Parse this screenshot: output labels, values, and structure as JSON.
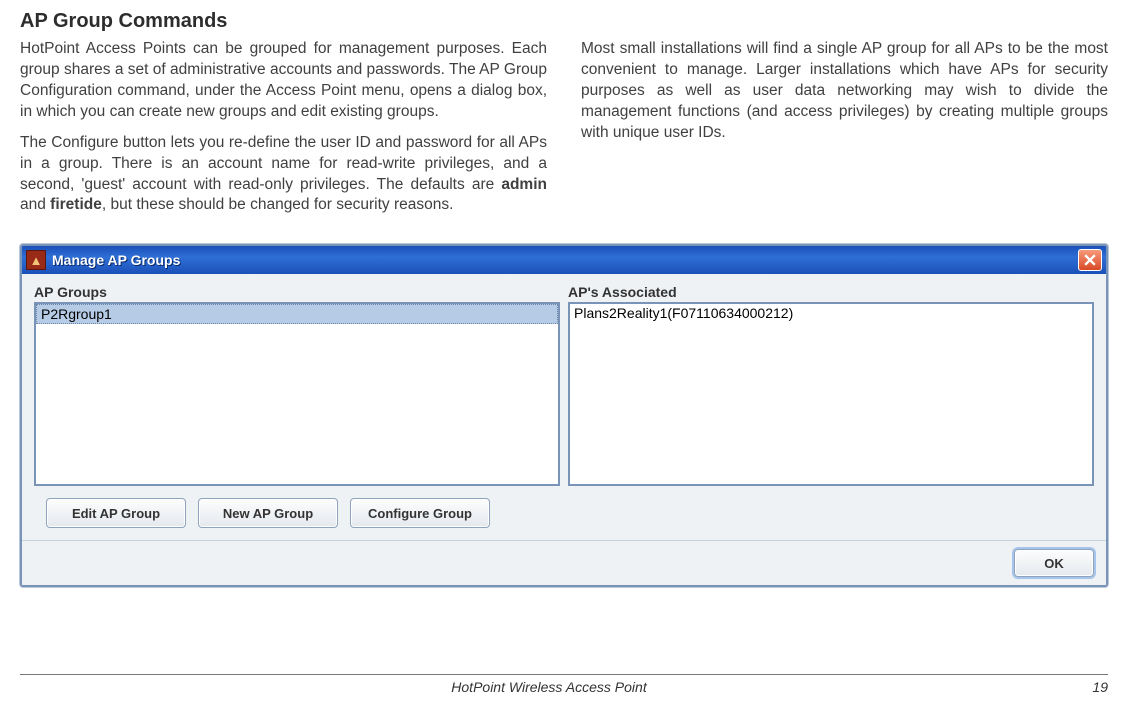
{
  "heading": "AP Group Commands",
  "paragraphs": {
    "p1": "HotPoint Access Points can be grouped for management purposes. Each group shares a set of administrative accounts and passwords. The AP Group Configuration command, under the Access Point menu, opens a dialog box, in which you can create new groups and edit existing groups.",
    "p2a": "The Configure button lets you re-define the user ID and password for all APs in a group. There is an account name for read-write privileges, and a second, 'guest' account with read-only privileges. The defaults are ",
    "p2b": "admin",
    "p2c": " and ",
    "p2d": "firetide",
    "p2e": ", but these should be changed for security reasons.",
    "p3": "Most small installations will find a single AP group for all APs to be the most convenient to manage. Larger installations which have APs for security purposes as well as user data networking may wish to divide the management functions (and access privileges) by creating multiple groups with unique user IDs."
  },
  "dialog": {
    "title": "Manage AP Groups",
    "groups_label": "AP Groups",
    "assoc_label": "AP's Associated",
    "group_item": "P2Rgroup1",
    "assoc_item": "Plans2Reality1(F07110634000212)",
    "buttons": {
      "edit": "Edit AP Group",
      "new": "New AP Group",
      "configure": "Configure Group",
      "ok": "OK"
    }
  },
  "footer": {
    "title": "HotPoint Wireless Access Point",
    "page": "19"
  }
}
